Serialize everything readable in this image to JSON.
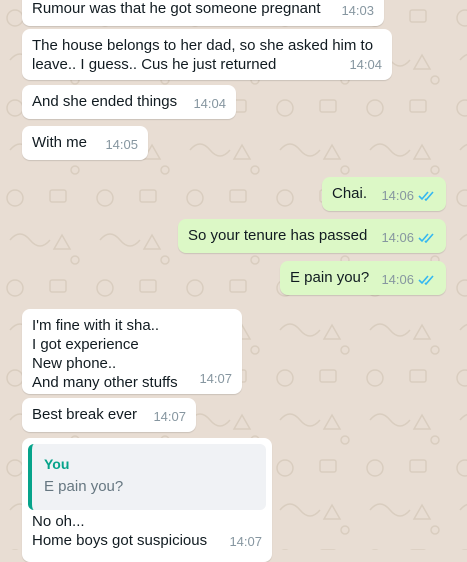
{
  "theme": {
    "incoming_bg": "#ffffff",
    "outgoing_bg": "#dcf8c6",
    "tick_color": "#34b7f1",
    "quote_accent": "#06a38a"
  },
  "messages": [
    {
      "direction": "in",
      "text": "Rumour was that he got someone pregnant",
      "time": "14:03"
    },
    {
      "direction": "in",
      "lines": [
        "The house belongs to her dad, so she asked him to",
        "leave.. I guess.. Cus he just returned"
      ],
      "time": "14:04"
    },
    {
      "direction": "in",
      "text": "And she ended things",
      "time": "14:04"
    },
    {
      "direction": "in",
      "text": "With me",
      "time": "14:05"
    },
    {
      "direction": "out",
      "text": "Chai.",
      "time": "14:06",
      "status_icon": "double-check-icon"
    },
    {
      "direction": "out",
      "text": "So your tenure has passed",
      "time": "14:06",
      "status_icon": "double-check-icon"
    },
    {
      "direction": "out",
      "text": "E pain you?",
      "time": "14:06",
      "status_icon": "double-check-icon"
    },
    {
      "direction": "in",
      "lines": [
        "I'm fine with it sha..",
        "I got experience",
        "New phone..",
        "And many other stuffs"
      ],
      "time": "14:07"
    },
    {
      "direction": "in",
      "text": "Best break ever",
      "time": "14:07"
    },
    {
      "direction": "in",
      "quote": {
        "author": "You",
        "text": "E pain you?"
      },
      "lines": [
        "No oh...",
        "Home boys got suspicious"
      ],
      "time": "14:07"
    }
  ]
}
